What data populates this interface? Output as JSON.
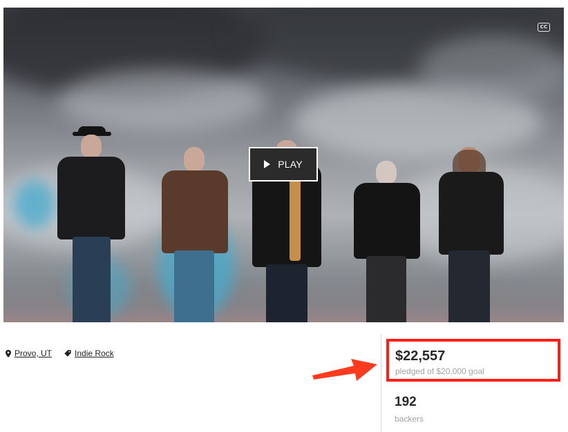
{
  "video": {
    "play_label": "PLAY",
    "cc_label": "CC"
  },
  "project": {
    "location": "Provo, UT",
    "category": "Indie Rock"
  },
  "stats": {
    "pledged_amount": "$22,557",
    "pledged_sub": "pledged of $20,000 goal",
    "backers_count": "192",
    "backers_label": "backers"
  },
  "colors": {
    "highlight": "#ff1f14",
    "play_bg": "#2b2b2b",
    "muted_text": "#a3a3a3"
  },
  "icons": {
    "location": "map-pin-icon",
    "category": "tag-icon",
    "play": "play-icon",
    "captions": "closed-captions-icon",
    "annotation": "red-arrow"
  }
}
